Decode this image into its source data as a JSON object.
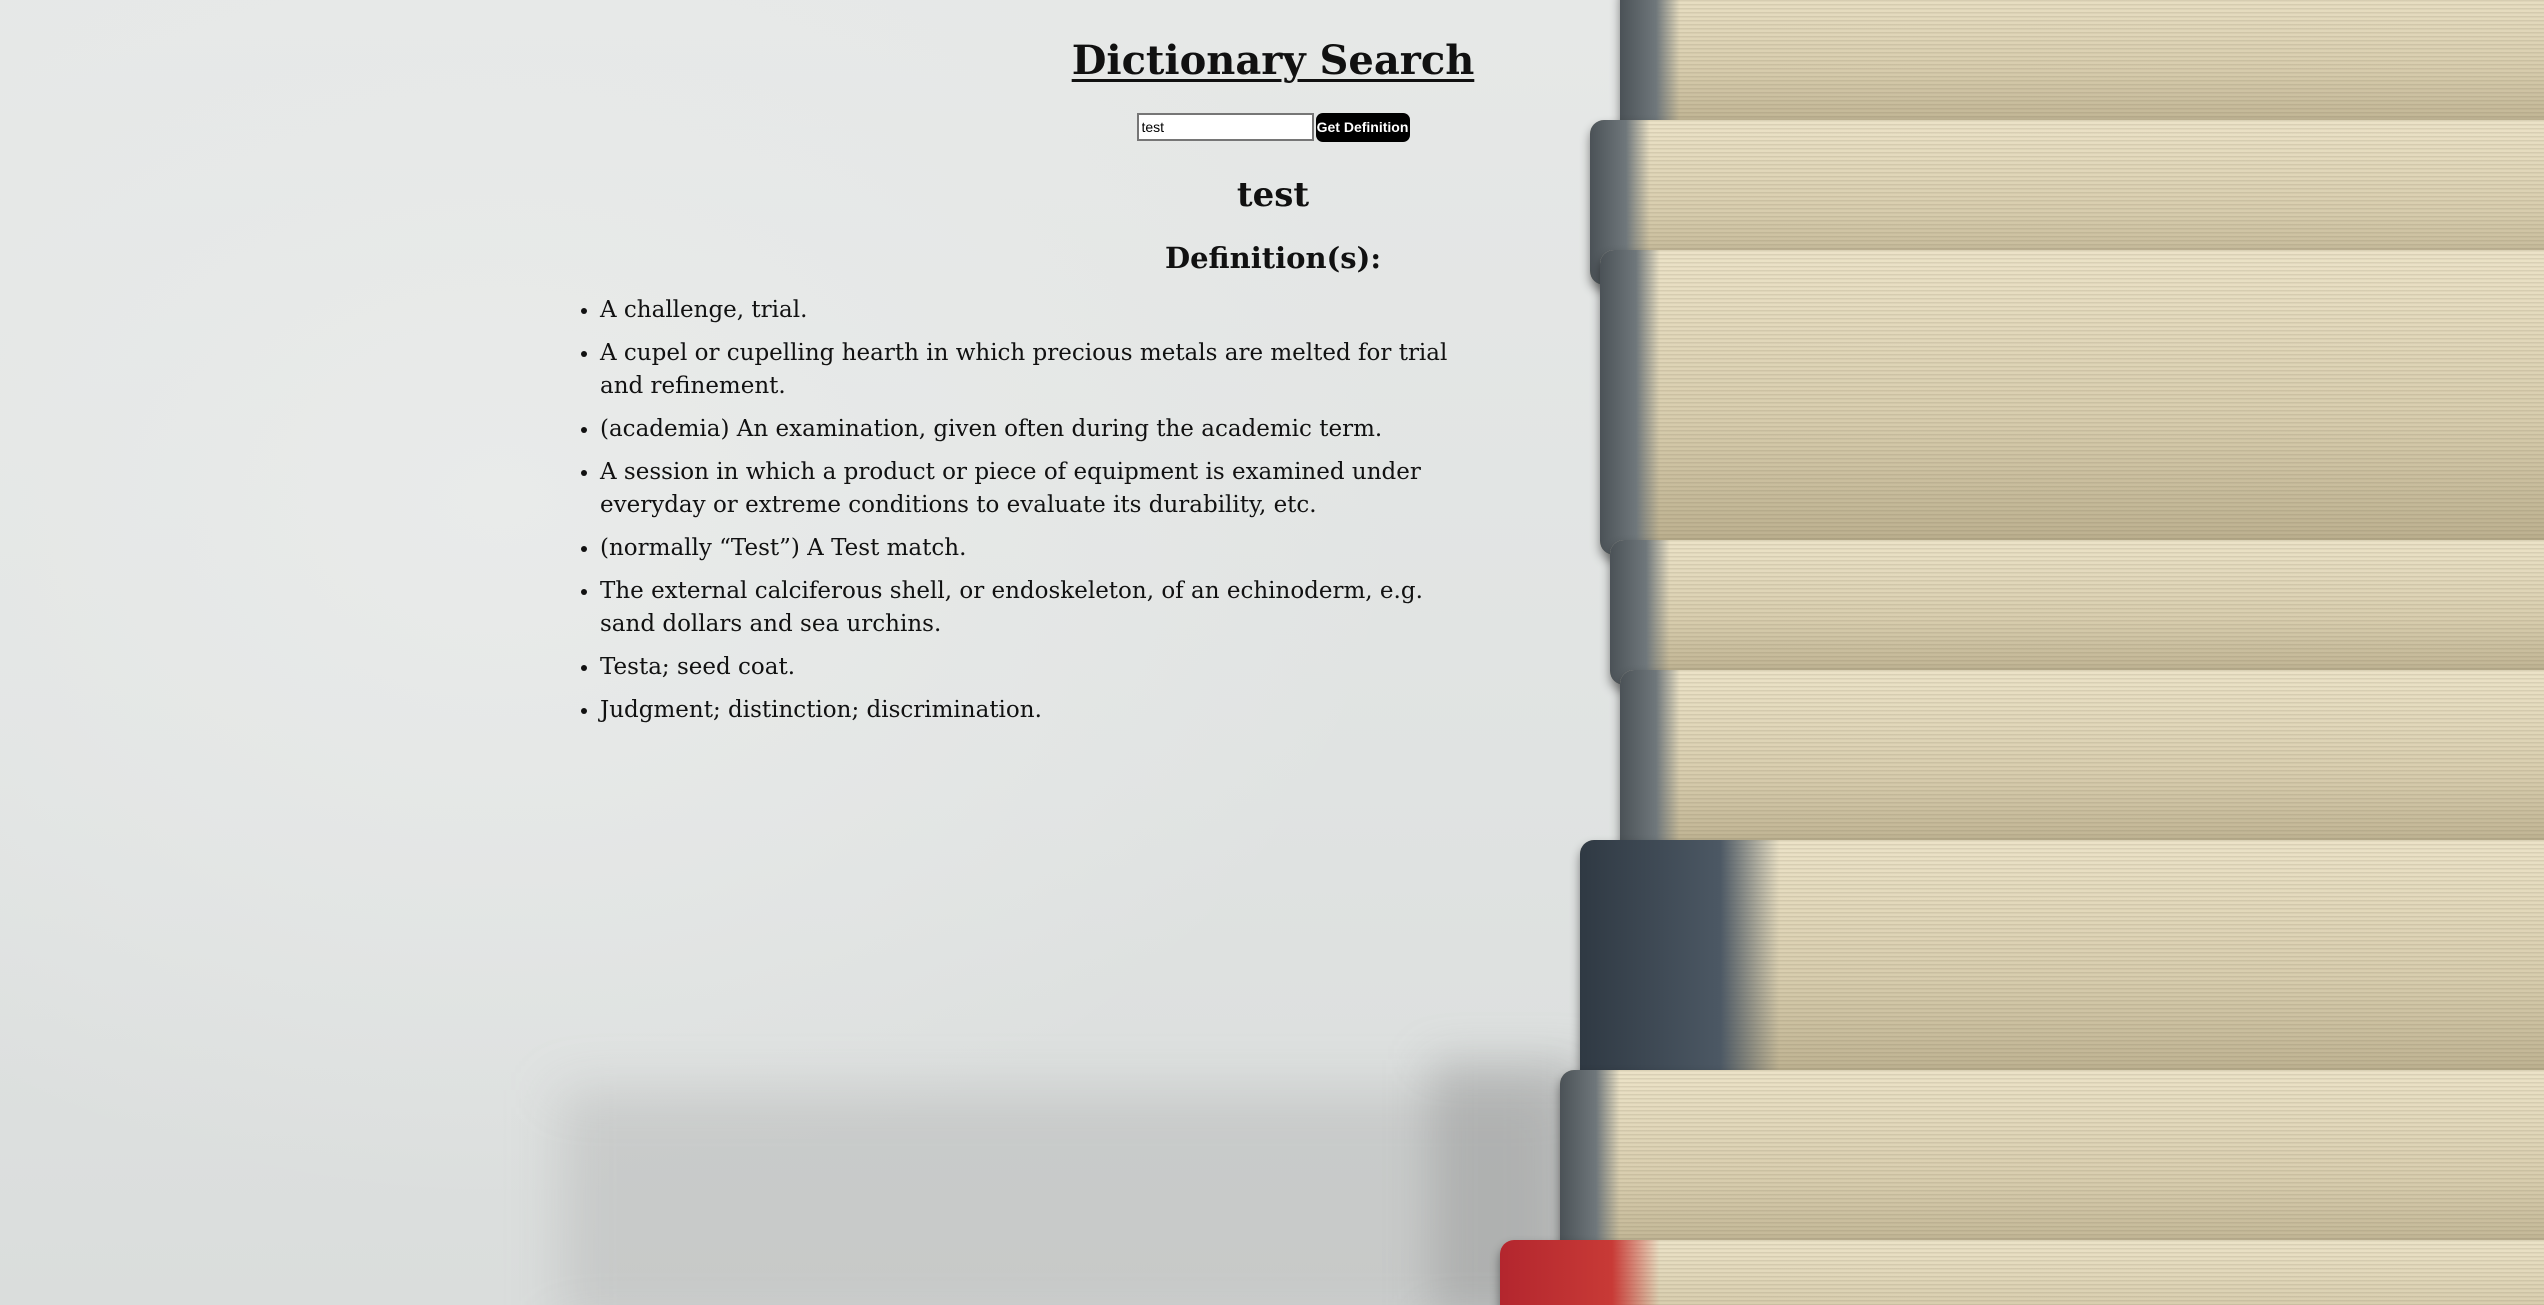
{
  "page": {
    "title": "Dictionary Search"
  },
  "search": {
    "value": "test",
    "placeholder": "",
    "button_label": "Get Definition"
  },
  "result": {
    "word": "test",
    "definitions_heading": "Definition(s):",
    "definitions": [
      "A challenge, trial.",
      "A cupel or cupelling hearth in which precious metals are melted for trial and refinement.",
      "(academia) An examination, given often during the academic term.",
      "A session in which a product or piece of equipment is examined under everyday or extreme conditions to evaluate its durability, etc.",
      "(normally “Test”) A Test match.",
      "The external calciferous shell, or endoskeleton, of an echinoderm, e.g. sand dollars and sea urchins.",
      "Testa; seed coat.",
      "Judgment; distinction; discrimination."
    ]
  },
  "colors": {
    "button_background": "#000000",
    "button_text": "#ffffff",
    "text": "#111111"
  }
}
